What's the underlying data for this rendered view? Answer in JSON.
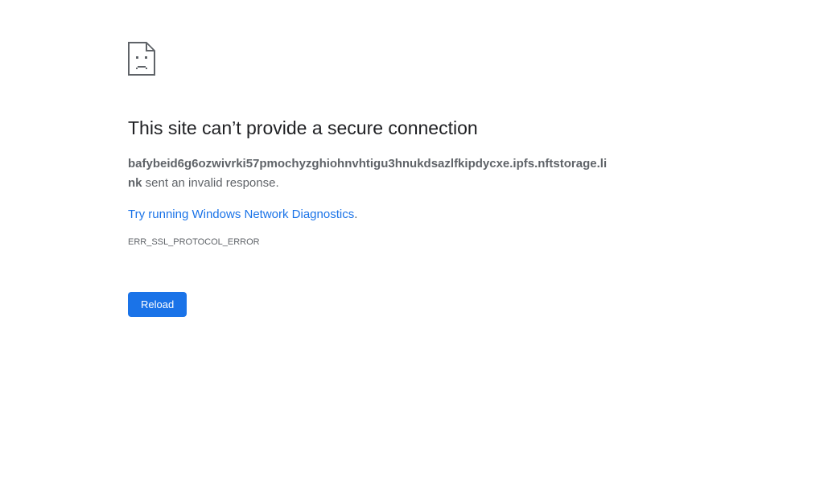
{
  "error": {
    "icon": "sad-document-icon",
    "title": "This site can’t provide a secure connection",
    "host": "bafybeid6g6ozwivrki57pmochyzghiohnvhtigu3hnukdsazlfkipdycxe.ipfs.nftstorage.link",
    "summary_suffix": " sent an invalid response.",
    "suggestion_link": "Try running Windows Network Diagnostics",
    "suggestion_suffix": ".",
    "code": "ERR_SSL_PROTOCOL_ERROR"
  },
  "actions": {
    "reload_label": "Reload"
  },
  "colors": {
    "accent": "#1a73e8",
    "text_primary": "#202124",
    "text_secondary": "#5f6368"
  }
}
